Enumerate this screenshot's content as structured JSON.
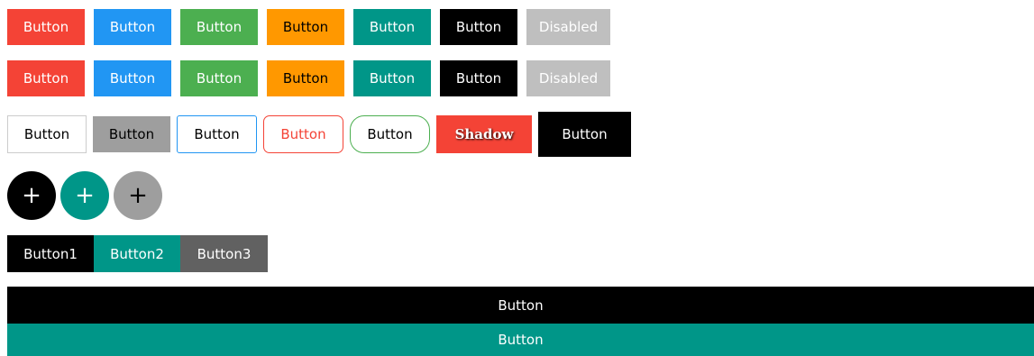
{
  "row1": {
    "buttons": [
      "Button",
      "Button",
      "Button",
      "Button",
      "Button",
      "Button",
      "Disabled"
    ]
  },
  "row2": {
    "buttons": [
      "Button",
      "Button",
      "Button",
      "Button",
      "Button",
      "Button",
      "Disabled"
    ]
  },
  "row3": {
    "buttons": [
      "Button",
      "Button",
      "Button",
      "Button",
      "Button",
      "Shadow",
      "Button"
    ]
  },
  "row4": {
    "circles": [
      "+",
      "+",
      "+"
    ]
  },
  "group": {
    "buttons": [
      "Button1",
      "Button2",
      "Button3"
    ]
  },
  "full": {
    "top_label": "Button",
    "bottom_label": "Button"
  },
  "colors": {
    "red": "#f44336",
    "blue": "#2196f3",
    "green": "#4caf50",
    "orange": "#ff9800",
    "teal": "#009688",
    "black": "#000000",
    "disabled": "#bfbfbf",
    "gray": "#9e9e9e",
    "dark_gray": "#616161"
  }
}
